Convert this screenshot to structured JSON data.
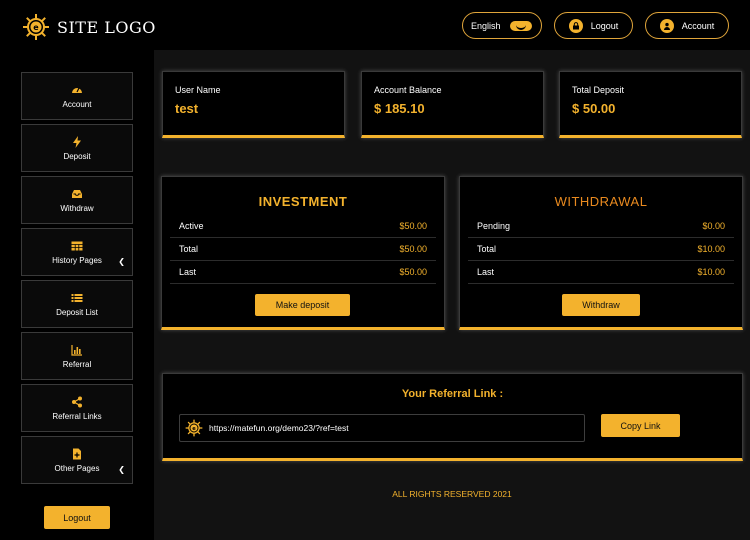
{
  "header": {
    "logo_text": "SITE LOGO",
    "language": "English",
    "logout_label": "Logout",
    "account_label": "Account"
  },
  "sidebar": {
    "items": [
      {
        "label": "Account",
        "icon": "dashboard-icon"
      },
      {
        "label": "Deposit",
        "icon": "bolt-icon"
      },
      {
        "label": "Withdraw",
        "icon": "inbox-icon"
      },
      {
        "label": "History Pages",
        "icon": "table-icon",
        "has_submenu": true
      },
      {
        "label": "Deposit List",
        "icon": "list-icon"
      },
      {
        "label": "Referral",
        "icon": "bar-chart-icon"
      },
      {
        "label": "Referral Links",
        "icon": "share-icon"
      },
      {
        "label": "Other Pages",
        "icon": "file-plus-icon",
        "has_submenu": true
      }
    ],
    "logout_label": "Logout"
  },
  "stats": [
    {
      "label": "User Name",
      "value": "test"
    },
    {
      "label": "Account Balance",
      "value": "$ 185.10"
    },
    {
      "label": "Total Deposit",
      "value": "$ 50.00"
    }
  ],
  "investment": {
    "title": "INVESTMENT",
    "rows": [
      {
        "label": "Active",
        "value": "$50.00"
      },
      {
        "label": "Total",
        "value": "$50.00"
      },
      {
        "label": "Last",
        "value": "$50.00"
      }
    ],
    "button_label": "Make deposit"
  },
  "withdrawal": {
    "title": "WITHDRAWAL",
    "rows": [
      {
        "label": "Pending",
        "value": "$0.00"
      },
      {
        "label": "Total",
        "value": "$10.00"
      },
      {
        "label": "Last",
        "value": "$10.00"
      }
    ],
    "button_label": "Withdraw"
  },
  "referral": {
    "title": "Your Referral Link :",
    "link": "https://matefun.org/demo23/?ref=test",
    "copy_label": "Copy Link"
  },
  "footer": {
    "text": "ALL RIGHTS RESERVED 2021"
  },
  "colors": {
    "accent": "#f3b22d",
    "accent_orange": "#e98a1f",
    "background": "#000000",
    "main_background": "#121212"
  }
}
